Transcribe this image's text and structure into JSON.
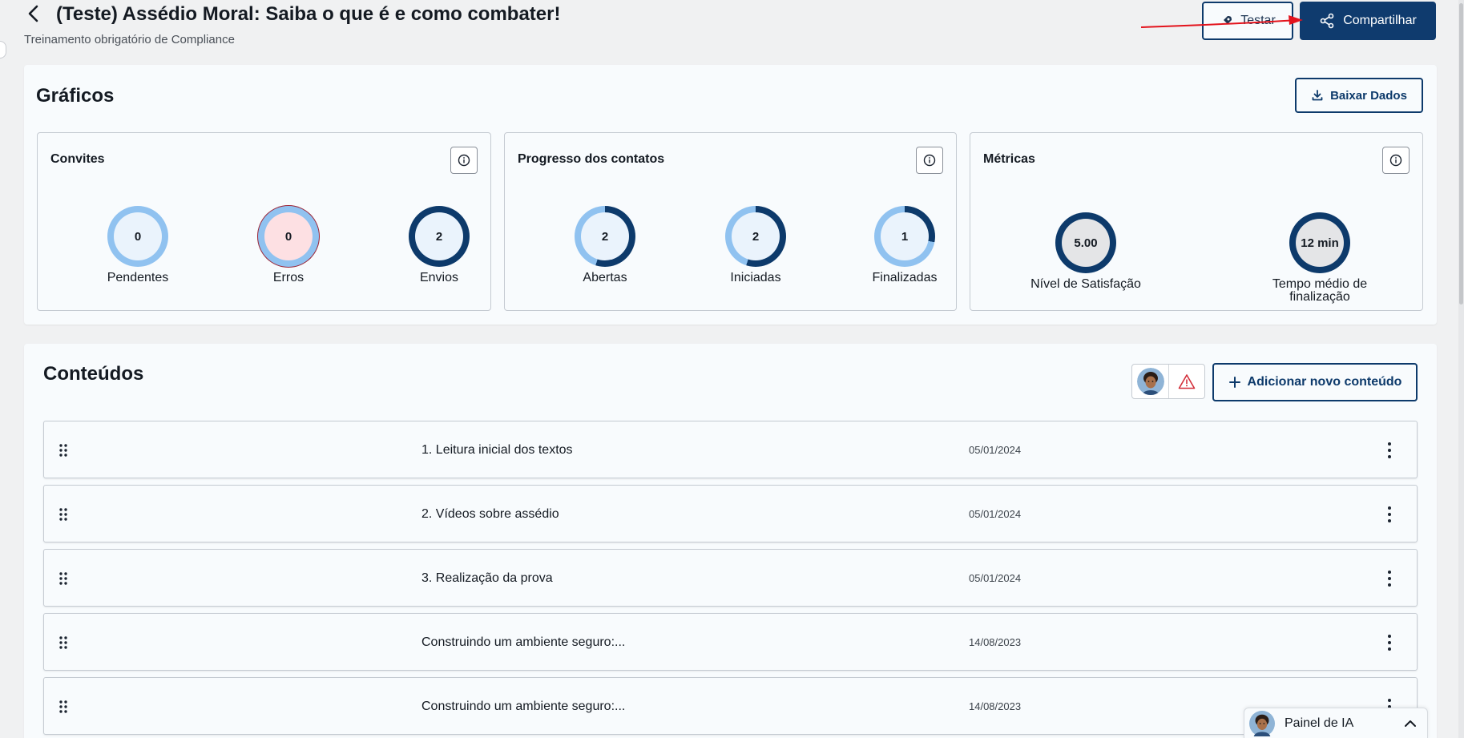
{
  "header": {
    "title": "(Teste) Assédio Moral: Saiba o que é e como combater!",
    "subtitle": "Treinamento obrigatório de Compliance",
    "testar_label": "Testar",
    "share_label": "Compartilhar"
  },
  "graficos": {
    "title": "Gráficos",
    "download_label": "Baixar Dados",
    "cards": [
      {
        "title": "Convites",
        "metrics": [
          {
            "label": "Pendentes",
            "value": "0",
            "fraction": 0
          },
          {
            "label": "Erros",
            "value": "0",
            "fraction": 0
          },
          {
            "label": "Envios",
            "value": "2",
            "fraction": 1
          }
        ]
      },
      {
        "title": "Progresso dos contatos",
        "metrics": [
          {
            "label": "Abertas",
            "value": "2",
            "fraction": 0.55
          },
          {
            "label": "Iniciadas",
            "value": "2",
            "fraction": 0.55
          },
          {
            "label": "Finalizadas",
            "value": "1",
            "fraction": 0.28
          }
        ]
      },
      {
        "title": "Métricas",
        "metrics": [
          {
            "label": "Nível de Satisfação",
            "value": "5.00"
          },
          {
            "label": "Tempo médio de finalização",
            "value": "12 min"
          }
        ]
      }
    ]
  },
  "conteudos": {
    "title": "Conteúdos",
    "add_label": "Adicionar novo conteúdo",
    "rows": [
      {
        "title": "1. Leitura inicial dos textos",
        "date": "05/01/2024"
      },
      {
        "title": "2. Vídeos sobre assédio",
        "date": "05/01/2024"
      },
      {
        "title": "3. Realização da prova",
        "date": "05/01/2024"
      },
      {
        "title": "Construindo um ambiente seguro:...",
        "date": "14/08/2023"
      },
      {
        "title": "Construindo um ambiente seguro:...",
        "date": "14/08/2023"
      }
    ]
  },
  "ia_panel": {
    "label": "Painel de IA"
  },
  "colors": {
    "primary": "#0f3b6e",
    "ring_light": "#90c2f0",
    "ring_dark": "#0d3a6b",
    "ring_inner": "#eaf3fc",
    "error_fill": "#fde0e3",
    "error_border": "#9b2335",
    "metric_fill": "#e4e5e7",
    "annotation_red": "#e3131c",
    "alert_red": "#d32f3a"
  },
  "icons": [
    "chevron-left-icon",
    "rocket-icon",
    "share-icon",
    "download-icon",
    "info-icon",
    "drag-handle-icon",
    "kebab-menu-icon",
    "plus-icon",
    "warning-icon",
    "chevron-up-icon",
    "avatar"
  ]
}
